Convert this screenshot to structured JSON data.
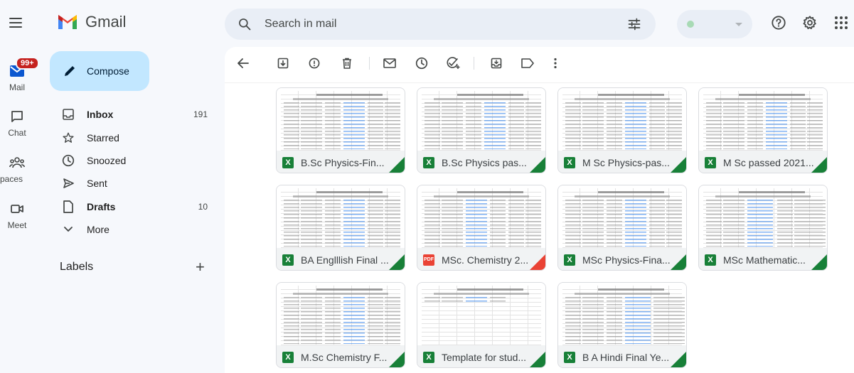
{
  "app": {
    "name": "Gmail"
  },
  "search": {
    "placeholder": "Search in mail"
  },
  "rail": {
    "mail_label": "Mail",
    "mail_badge": "99+",
    "chat_label": "Chat",
    "spaces_label": "paces",
    "meet_label": "Meet"
  },
  "compose_label": "Compose",
  "nav": {
    "inbox": {
      "label": "Inbox",
      "count": "191"
    },
    "starred": {
      "label": "Starred"
    },
    "snoozed": {
      "label": "Snoozed"
    },
    "sent": {
      "label": "Sent"
    },
    "drafts": {
      "label": "Drafts",
      "count": "10"
    },
    "more": {
      "label": "More"
    }
  },
  "labels_header": "Labels",
  "labels_add": "+",
  "attachments": [
    {
      "name": "B.Sc Physics-Fin...",
      "type": "X"
    },
    {
      "name": "B.Sc Physics pas...",
      "type": "X"
    },
    {
      "name": "M Sc Physics-pas...",
      "type": "X"
    },
    {
      "name": "M Sc passed 2021...",
      "type": "X"
    },
    {
      "name": "BA Englllish Final ...",
      "type": "X"
    },
    {
      "name": "MSc. Chemistry 2...",
      "type": "PDF"
    },
    {
      "name": "MSc Physics-Fina...",
      "type": "X"
    },
    {
      "name": "MSc Mathematic...",
      "type": "X"
    },
    {
      "name": "M.Sc Chemistry F...",
      "type": "X"
    },
    {
      "name": "Template for stud...",
      "type": "X"
    },
    {
      "name": "B A Hindi Final Ye...",
      "type": "X"
    }
  ],
  "colors": {
    "accent": "#c2e7ff",
    "excel": "#188038",
    "pdf": "#ea4335",
    "badge": "#c5221f"
  }
}
